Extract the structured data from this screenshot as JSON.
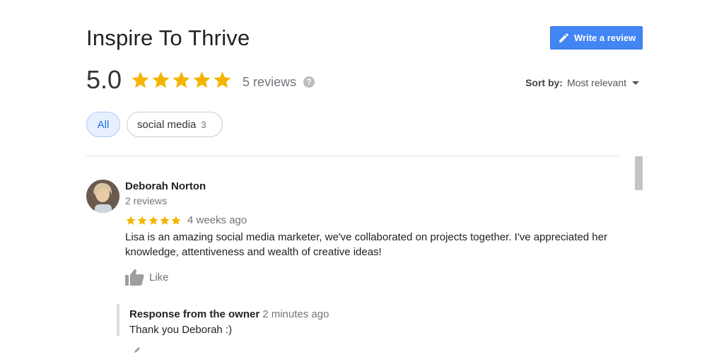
{
  "business": {
    "name": "Inspire To Thrive",
    "rating": "5.0",
    "star_count": 5,
    "review_count_label": "5 reviews",
    "help_glyph": "?"
  },
  "toolbar": {
    "write_review_label": "Write a review",
    "sort_label": "Sort by:",
    "sort_value": "Most relevant"
  },
  "filters": {
    "all_label": "All",
    "topic_label": "social media",
    "topic_count": "3"
  },
  "review": {
    "author": "Deborah Norton",
    "author_reviews": "2 reviews",
    "stars": 5,
    "time": "4 weeks ago",
    "text": "Lisa is an amazing social media marketer, we've collaborated on projects together.   I've appreciated her knowledge, attentiveness and wealth of creative ideas!",
    "like_label": "Like",
    "owner_response": {
      "title": "Response from the owner",
      "time": "2 minutes ago",
      "text": "Thank you Deborah :)"
    }
  },
  "colors": {
    "star": "#f4b400",
    "accent": "#4285f4",
    "muted": "#70757a"
  }
}
